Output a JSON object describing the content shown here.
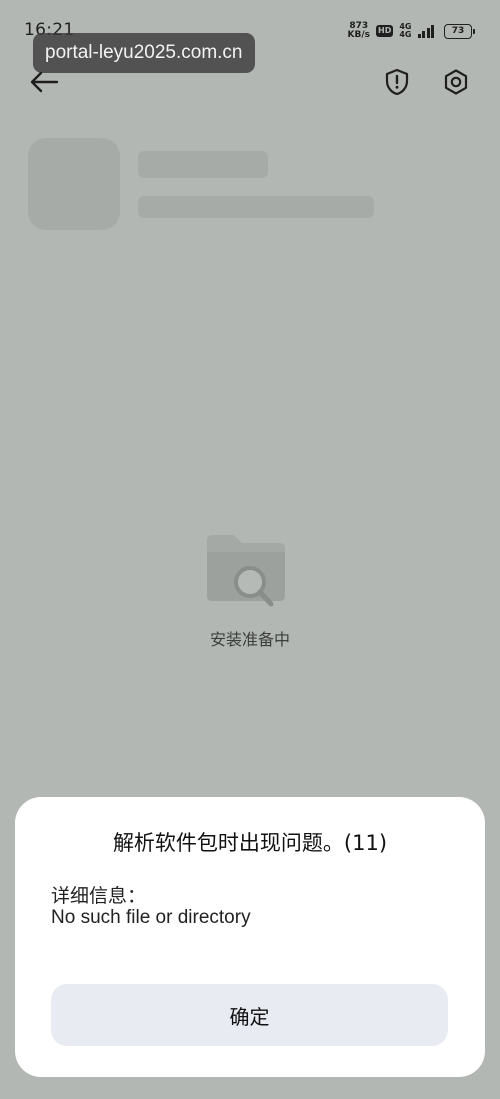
{
  "status_bar": {
    "time": "16:21",
    "speed_value": "873",
    "speed_unit": "KB/s",
    "hd_badge": "HD",
    "network_top": "4G",
    "network_bottom": "4G",
    "battery_level": "73"
  },
  "watermark": {
    "url": "portal-leyu2025.com.cn"
  },
  "nav": {
    "back_icon": "arrow-left-icon",
    "shield_icon": "shield-alert-icon",
    "settings_icon": "gear-icon"
  },
  "installer": {
    "status_text": "安装准备中",
    "illustration_icon": "folder-search-icon"
  },
  "dialog": {
    "title": "解析软件包时出现问题。(11)",
    "detail_label": "详细信息：",
    "detail_message": "No such file or directory",
    "confirm_label": "确定"
  },
  "colors": {
    "overlay_background": "#b3b7b3",
    "dialog_background": "#ffffff",
    "button_background": "#e8ebf2"
  }
}
